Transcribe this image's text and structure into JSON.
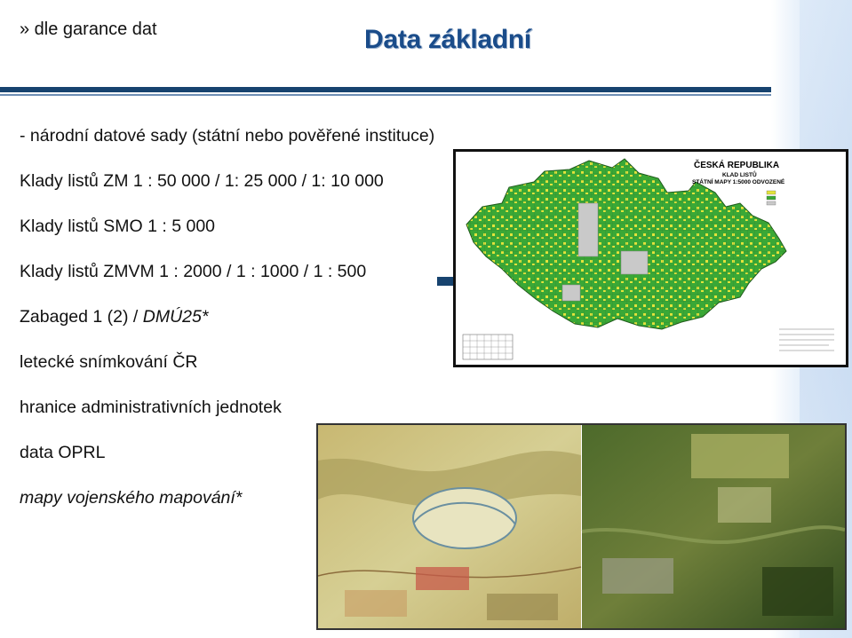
{
  "breadcrumb": "» dle garance dat",
  "title": "Data základní",
  "items": [
    {
      "text": "- národní datové sady (státní nebo pověřené instituce)",
      "italic": false
    },
    {
      "text": "Klady listů ZM 1 : 50 000 / 1: 25 000 / 1: 10  000",
      "italic": false
    },
    {
      "text": "Klady listů SMO 1 : 5 000",
      "italic": false
    },
    {
      "text": "Klady listů ZMVM 1 : 2000 / 1 : 1000  /  1 : 500",
      "italic": false
    },
    {
      "text_plain": "Zabaged 1 (2)  / ",
      "text_italic": "DMÚ25*"
    },
    {
      "text": "letecké snímkování ČR",
      "italic": false
    },
    {
      "text": "hranice administrativních jednotek",
      "italic": false
    },
    {
      "text": "data OPRL",
      "italic": false
    },
    {
      "text": "mapy vojenského mapování*",
      "italic": true
    }
  ],
  "map": {
    "heading": "ČESKÁ  REPUBLIKA",
    "subheading": "KLAD LISTŮ",
    "subheading2": "STÁTNÍ  MAPY 1:5000  ODVOZENÉ",
    "colors": {
      "green": "#3aa836",
      "yellow": "#e3e33c",
      "grey": "#c9c9c9"
    }
  },
  "photos": {
    "left": "historical-map",
    "right": "aerial-photo"
  }
}
